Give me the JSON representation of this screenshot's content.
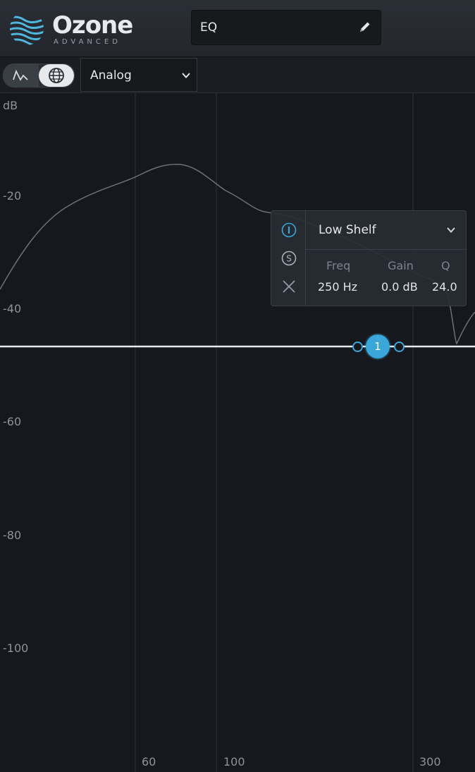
{
  "app": {
    "name": "Ozone",
    "edition": "ADVANCED",
    "module_name": "EQ"
  },
  "toolbar": {
    "mode": "Analog"
  },
  "graph": {
    "unit_label": "dB",
    "db_labels": [
      "-20",
      "-40",
      "-60",
      "-80",
      "-100"
    ],
    "freq_labels": [
      "60",
      "100",
      "300"
    ]
  },
  "band": {
    "number": "1",
    "type": "Low Shelf",
    "freq_label": "Freq",
    "gain_label": "Gain",
    "q_label": "Q",
    "freq_value": "250 Hz",
    "gain_value": "0.0 dB",
    "q_value": "24.0"
  },
  "colors": {
    "accent": "#3aa6d9",
    "background": "#16181d"
  },
  "icons": {
    "band_enable": "power-icon",
    "band_solo": "solo-icon",
    "band_remove": "close-icon",
    "edit": "pencil-icon",
    "dropdown": "chevron-down-icon"
  }
}
